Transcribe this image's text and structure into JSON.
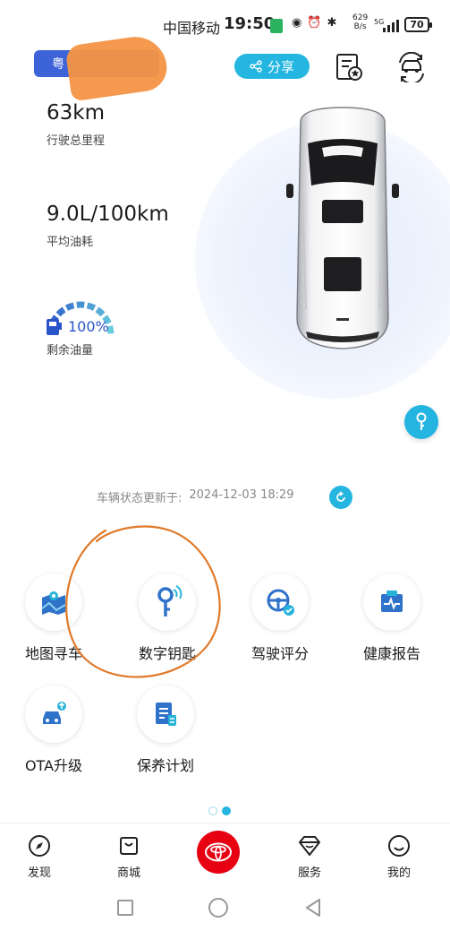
{
  "status_bar": {
    "carrier": "中国移动",
    "time": "19:50",
    "net_speed_value": "629",
    "net_speed_unit": "B/s",
    "network": "5G",
    "battery": "70"
  },
  "header": {
    "plate_text": "粤",
    "share_label": "分享"
  },
  "stats": {
    "mileage_value": "63km",
    "mileage_label": "行驶总里程",
    "fuel_consumption_value": "9.0L/100km",
    "fuel_consumption_label": "平均油耗",
    "fuel_level_value": "100%",
    "fuel_level_label": "剩余油量",
    "fuel_level_fraction": 1.0
  },
  "update": {
    "label": "车辆状态更新于:",
    "timestamp": "2024-12-03 18:29"
  },
  "services": [
    {
      "label": "地图寻车",
      "icon": "map-pin-icon"
    },
    {
      "label": "数字钥匙",
      "icon": "key-icon"
    },
    {
      "label": "驾驶评分",
      "icon": "steering-wheel-icon"
    },
    {
      "label": "健康报告",
      "icon": "health-report-icon"
    },
    {
      "label": "OTA升级",
      "icon": "ota-car-icon"
    },
    {
      "label": "保养计划",
      "icon": "maintenance-doc-icon"
    }
  ],
  "pager": {
    "current": 2,
    "total": 2
  },
  "bottom_nav": [
    {
      "label": "发现",
      "icon": "compass-icon"
    },
    {
      "label": "商城",
      "icon": "shopping-bag-icon"
    },
    {
      "label": "",
      "icon": "toyota-logo-icon"
    },
    {
      "label": "服务",
      "icon": "diamond-icon"
    },
    {
      "label": "我的",
      "icon": "smiley-icon"
    }
  ],
  "colors": {
    "accent": "#24b6e0",
    "plate_blue": "#3d63d9",
    "brand_red": "#e60012",
    "annotation_orange": "#e07a2a"
  }
}
